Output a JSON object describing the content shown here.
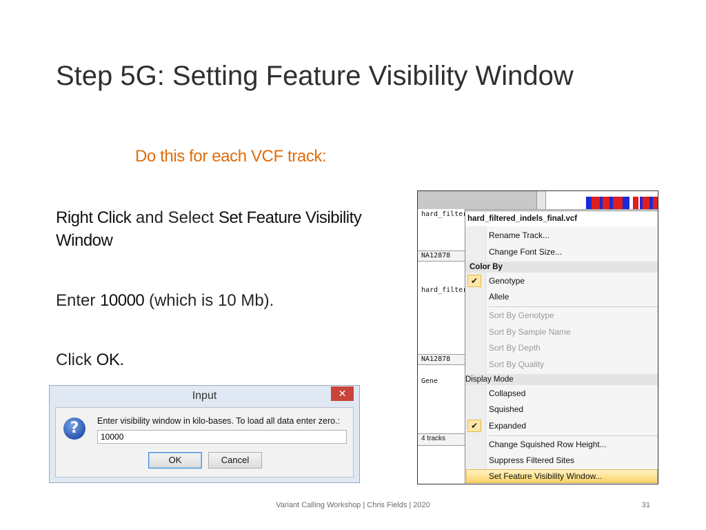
{
  "slide": {
    "title": "Step 5G: Setting Feature Visibility Window",
    "subtitle": "Do this for each VCF track:",
    "line1": {
      "bold1": "Right Click",
      "mid": " and Select ",
      "bold2": "Set Feature Visibility Window"
    },
    "line2": {
      "pre": "Enter ",
      "bold": "10000",
      "post": " (which is 10 Mb)."
    },
    "line3": {
      "pre": "Click ",
      "bold": "OK."
    },
    "footer": "Variant Calling Workshop | Chris Fields | 2020",
    "page_number": "31"
  },
  "dialog": {
    "title": "Input",
    "close_icon": "close-icon",
    "question_icon": "question-icon",
    "prompt": "Enter visibility window in kilo-bases.  To load all data enter zero.:",
    "input_value": "10000",
    "ok_label": "OK",
    "cancel_label": "Cancel"
  },
  "igv": {
    "track_names": {
      "t1": "hard_filtere",
      "t2": "NA12878",
      "t3": "hard_filtere",
      "t4": "NA12878",
      "t5": "Gene",
      "t6": "4 tracks"
    },
    "colors": {
      "variant_red": "#e01e1e",
      "variant_blue": "#1b2ad6"
    },
    "menu": {
      "header": "hard_filtered_indels_final.vcf",
      "rename": "Rename Track...",
      "font_size": "Change Font Size...",
      "color_by": "Color By",
      "genotype": "Genotype",
      "allele": "Allele",
      "sort_genotype": "Sort By Genotype",
      "sort_sample": "Sort By Sample Name",
      "sort_depth": "Sort By Depth",
      "sort_quality": "Sort By Quality",
      "display_mode": "Display Mode",
      "collapsed": "Collapsed",
      "squished": "Squished",
      "expanded": "Expanded",
      "squished_height": "Change Squished Row Height...",
      "suppress": "Suppress Filtered Sites",
      "set_visibility": "Set Feature Visibility Window...",
      "check_glyph": "✔"
    }
  }
}
